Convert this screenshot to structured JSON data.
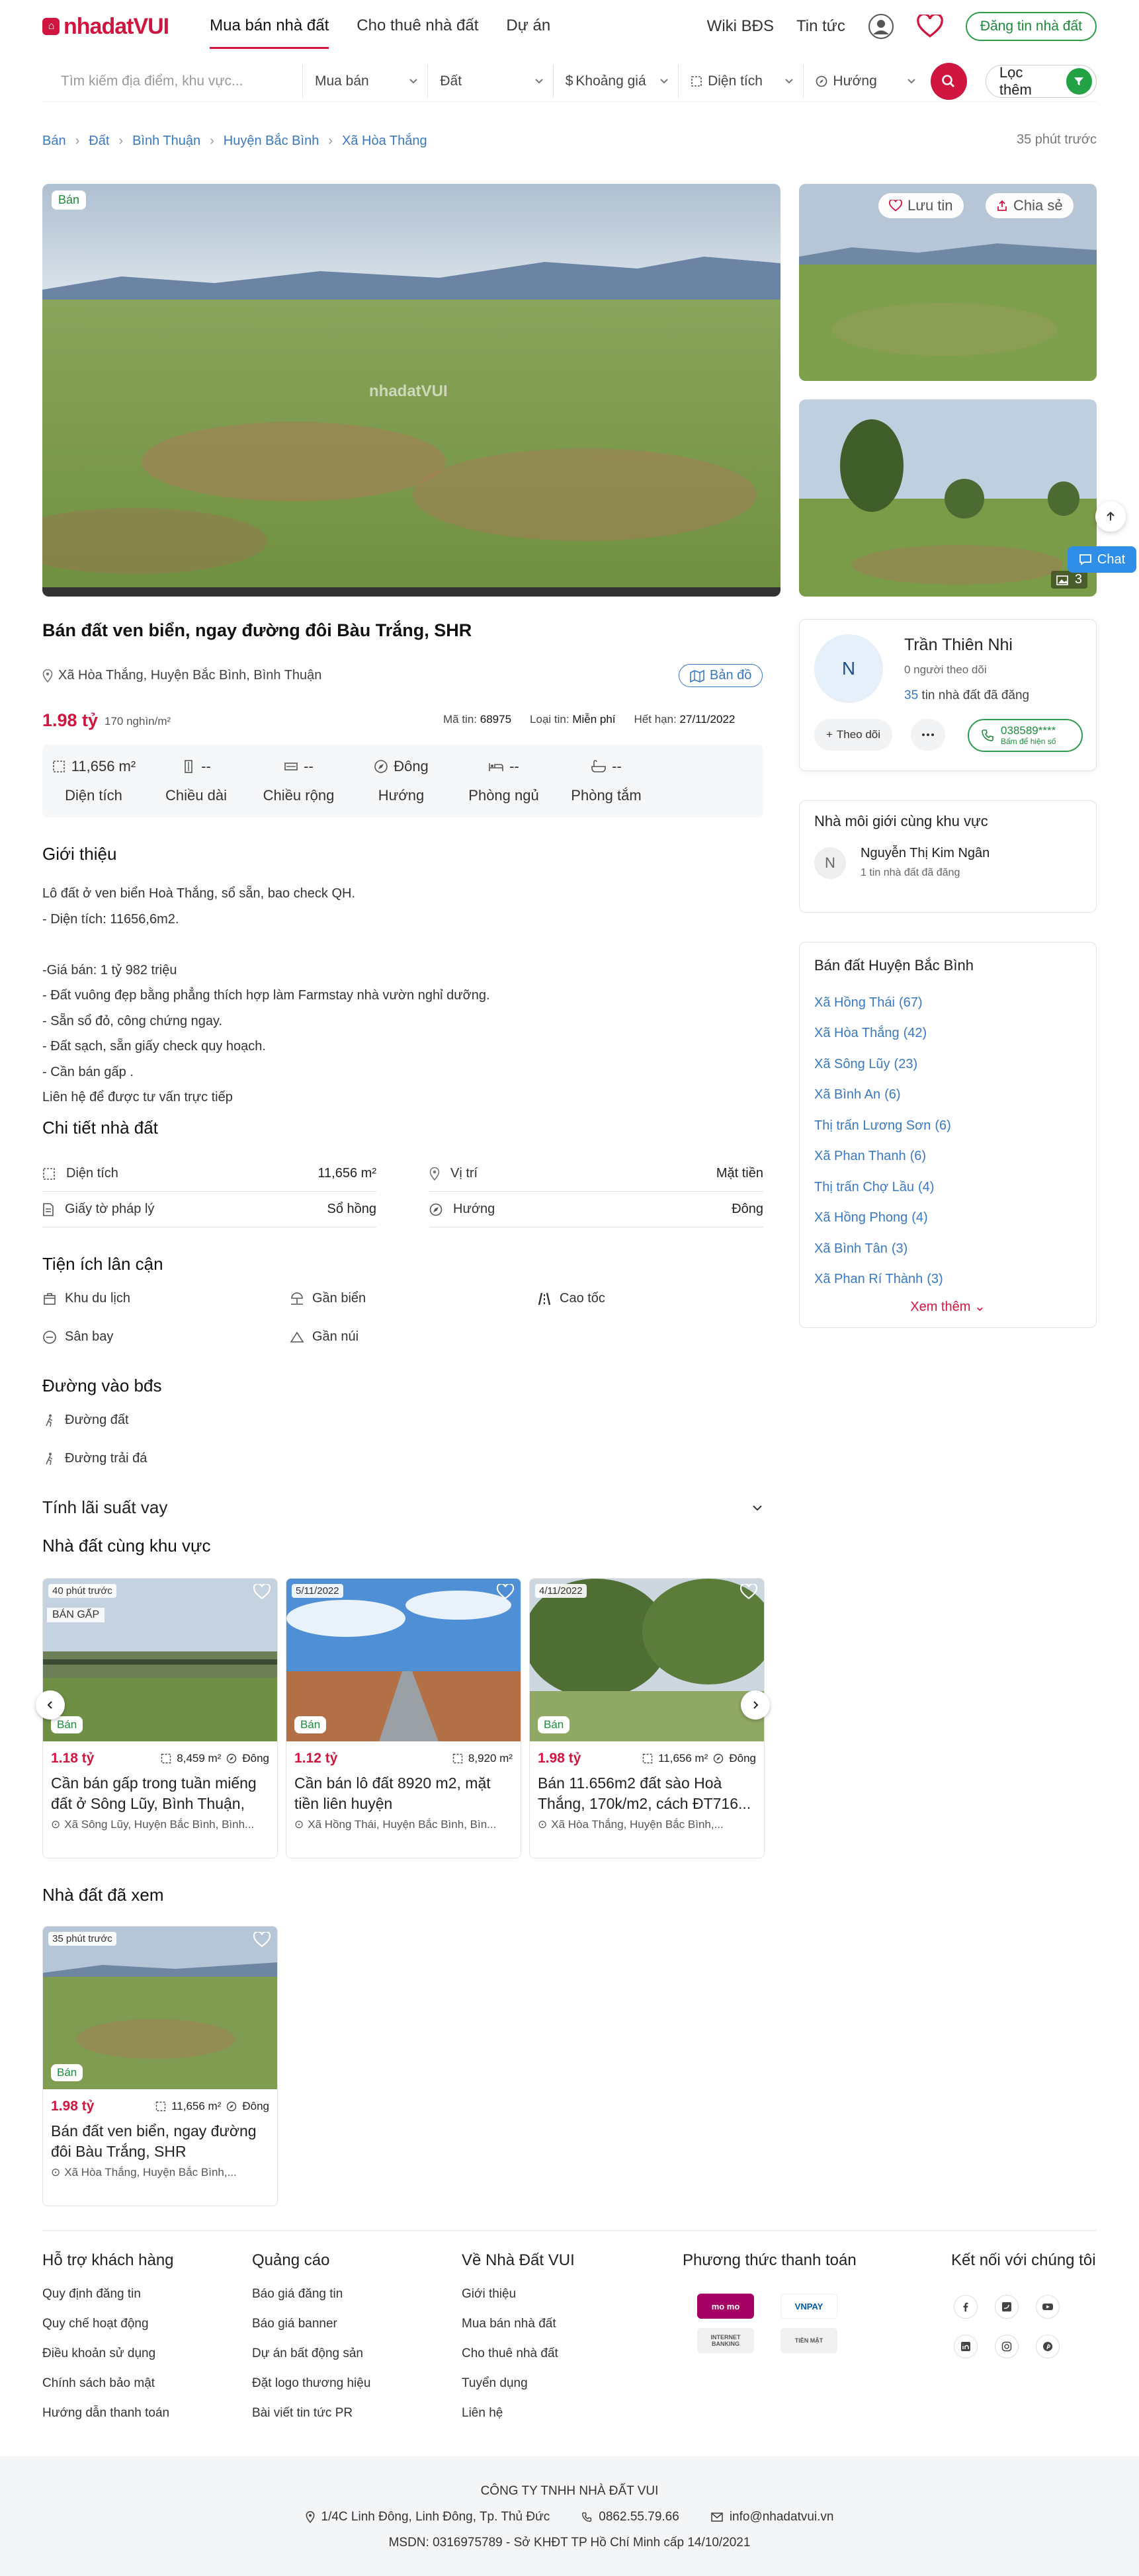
{
  "header": {
    "logo": "nhadatVUI",
    "nav": [
      "Mua bán nhà đất",
      "Cho thuê nhà đất",
      "Dự án"
    ],
    "links": [
      "Wiki BĐS",
      "Tin tức"
    ],
    "post_label": "Đăng tin nhà đất"
  },
  "search": {
    "placeholder": "Tìm kiếm địa điểm, khu vực...",
    "type": "Mua bán",
    "category": "Đất",
    "price": "Khoảng giá",
    "area": "Diện tích",
    "direction": "Hướng",
    "filter_label": "Lọc thêm"
  },
  "breadcrumb": [
    "Bán",
    "Đất",
    "Bình Thuận",
    "Huyện Bắc Bình",
    "Xã Hòa Thắng"
  ],
  "posted_ago": "35 phút trước",
  "gallery": {
    "badge": "Bán",
    "save_label": "Lưu tin",
    "share_label": "Chia sẻ",
    "photo_count": "3",
    "watermark": "nhadatVUI"
  },
  "floating": {
    "chat_label": "Chat"
  },
  "listing": {
    "title": "Bán đất ven biển, ngay đường đôi Bàu Trắng, SHR",
    "address": "Xã Hòa Thắng, Huyện Bắc Bình, Bình Thuận",
    "map_label": "Bản đồ",
    "price": "1.98 tỷ",
    "price_per_m2": "170 nghìn/m²",
    "code_label": "Mã tin:",
    "code": "68975",
    "type_label": "Loại tin:",
    "type": "Miễn phí",
    "expiry_label": "Hết hạn:",
    "expiry": "27/11/2022",
    "specs": [
      {
        "icon": "area-icon",
        "value": "11,656 m²",
        "label": "Diện tích"
      },
      {
        "icon": "length-icon",
        "value": "--",
        "label": "Chiều dài"
      },
      {
        "icon": "width-icon",
        "value": "--",
        "label": "Chiều rộng"
      },
      {
        "icon": "compass-icon",
        "value": "Đông",
        "label": "Hướng"
      },
      {
        "icon": "bed-icon",
        "value": "--",
        "label": "Phòng ngủ"
      },
      {
        "icon": "bath-icon",
        "value": "--",
        "label": "Phòng tắm"
      }
    ]
  },
  "intro": {
    "heading": "Giới thiệu",
    "lines": [
      "Lô đất ở ven biển Hoà Thắng, sổ sẵn, bao check QH.",
      "- Diện tích: 11656,6m2.",
      "",
      "-Giá bán: 1 tỷ 982 triệu",
      "- Đất vuông đẹp bằng phẳng thích hợp làm Farmstay nhà vườn nghỉ dưỡng.",
      "- Sẵn sổ đỏ, công chứng ngay.",
      "- Đất sạch, sẵn giấy check quy hoạch.",
      "- Cần bán gấp .",
      "Liên hệ để được tư vấn trực tiếp"
    ]
  },
  "details": {
    "heading": "Chi tiết nhà đất",
    "rows": [
      [
        {
          "icon": "area-icon",
          "label": "Diện tích",
          "value": "11,656 m²"
        },
        {
          "icon": "location-icon",
          "label": "Vị trí",
          "value": "Mặt tiền"
        }
      ],
      [
        {
          "icon": "document-icon",
          "label": "Giấy tờ pháp lý",
          "value": "Sổ hồng"
        },
        {
          "icon": "compass-icon",
          "label": "Hướng",
          "value": "Đông"
        }
      ]
    ]
  },
  "amenities": {
    "heading": "Tiện ích lân cận",
    "items": [
      {
        "icon": "tourism-icon",
        "label": "Khu du lịch"
      },
      {
        "icon": "beach-icon",
        "label": "Gần biển"
      },
      {
        "icon": "highway-icon",
        "label": "Cao tốc"
      },
      {
        "icon": "airport-icon",
        "label": "Sân bay"
      },
      {
        "icon": "mountain-icon",
        "label": "Gần núi"
      }
    ]
  },
  "road": {
    "heading": "Đường vào bđs",
    "items": [
      "Đường đất",
      "Đường trải đá"
    ]
  },
  "loan": {
    "heading": "Tính lãi suất vay"
  },
  "nearby": {
    "heading": "Nhà đất cùng khu vực",
    "cards": [
      {
        "date": "40 phút trước",
        "tag": "BÁN GẤP",
        "badge": "Bán",
        "price": "1.18 tỷ",
        "area": "8,459 m²",
        "direction": "Đông",
        "title": "Cần bán gấp trong tuần miếng đất ở Sông Lũy, Bình Thuận, số...",
        "address": "Xã Sông Lũy, Huyện Bắc Bình, Bình..."
      },
      {
        "date": "5/11/2022",
        "tag": "",
        "badge": "Bán",
        "price": "1.12 tỷ",
        "area": "8,920 m²",
        "direction": "",
        "title": "Cần bán lô đất 8920 m2, mặt tiền liên huyện",
        "address": "Xã Hồng Thái, Huyện Bắc Bình, Bìn..."
      },
      {
        "date": "4/11/2022",
        "tag": "",
        "badge": "Bán",
        "price": "1.98 tỷ",
        "area": "11,656 m²",
        "direction": "Đông",
        "title": "Bán 11.656m2 đất sào Hoà Thắng, 170k/m2, cách ĐT716...",
        "address": "Xã Hòa Thắng, Huyện Bắc Bình,..."
      }
    ]
  },
  "viewed": {
    "heading": "Nhà đất đã xem",
    "card": {
      "date": "35 phút trước",
      "badge": "Bán",
      "price": "1.98 tỷ",
      "area": "11,656 m²",
      "direction": "Đông",
      "title": "Bán đất ven biển, ngay đường đôi Bàu Trắng, SHR",
      "address": "Xã Hòa Thắng, Huyện Bắc Bình,..."
    }
  },
  "agent": {
    "initial": "N",
    "name": "Trần Thiên Nhi",
    "followers": "0 người theo dõi",
    "listing_count": "35",
    "listing_text": "tin nhà đất đã đăng",
    "follow_label": "Theo dõi",
    "phone": "038589****",
    "phone_hint": "Bấm để hiện số"
  },
  "brokers": {
    "heading": "Nhà môi giới cùng khu vực",
    "items": [
      {
        "initial": "N",
        "name": "Nguyễn Thị Kim Ngân",
        "stat": "1 tin nhà đất đã đăng"
      }
    ]
  },
  "areas": {
    "heading": "Bán đất Huyện Bắc Bình",
    "items": [
      {
        "name": "Xã Hồng Thái",
        "count": "(67)"
      },
      {
        "name": "Xã Hòa Thắng",
        "count": "(42)"
      },
      {
        "name": "Xã Sông Lũy",
        "count": "(23)"
      },
      {
        "name": "Xã Bình An",
        "count": "(6)"
      },
      {
        "name": "Thị trấn Lương Sơn",
        "count": "(6)"
      },
      {
        "name": "Xã Phan Thanh",
        "count": "(6)"
      },
      {
        "name": "Thị trấn Chợ Lầu",
        "count": "(4)"
      },
      {
        "name": "Xã Hồng Phong",
        "count": "(4)"
      },
      {
        "name": "Xã Bình Tân",
        "count": "(3)"
      },
      {
        "name": "Xã Phan Rí Thành",
        "count": "(3)"
      }
    ],
    "more_label": "Xem thêm"
  },
  "footer": {
    "support": {
      "heading": "Hỗ trợ khách hàng",
      "links": [
        "Quy định đăng tin",
        "Quy chế hoạt động",
        "Điều khoản sử dụng",
        "Chính sách bảo mật",
        "Hướng dẫn thanh toán"
      ]
    },
    "ads": {
      "heading": "Quảng cáo",
      "links": [
        "Báo giá đăng tin",
        "Báo giá banner",
        "Dự án bất động sản",
        "Đặt logo thương hiệu",
        "Bài viết tin tức PR"
      ]
    },
    "about": {
      "heading": "Về Nhà Đất VUI",
      "links": [
        "Giới thiệu",
        "Mua bán nhà đất",
        "Cho thuê nhà đất",
        "Tuyển dụng",
        "Liên hệ"
      ]
    },
    "payment": {
      "heading": "Phương thức thanh toán",
      "methods": [
        "mo mo",
        "VNPAY",
        "INTERNET BANKING",
        "TIỀN MẶT"
      ]
    },
    "social": {
      "heading": "Kết nối với chúng tôi"
    },
    "company": "CÔNG TY TNHH NHÀ ĐẤT VUI",
    "address": "1/4C Linh Đông, Linh Đông, Tp. Thủ Đức",
    "phone": "0862.55.79.66",
    "email": "info@nhadatvui.vn",
    "license": "MSDN: 0316975789 - Sở KHĐT TP Hồ Chí Minh cấp 14/10/2021"
  }
}
